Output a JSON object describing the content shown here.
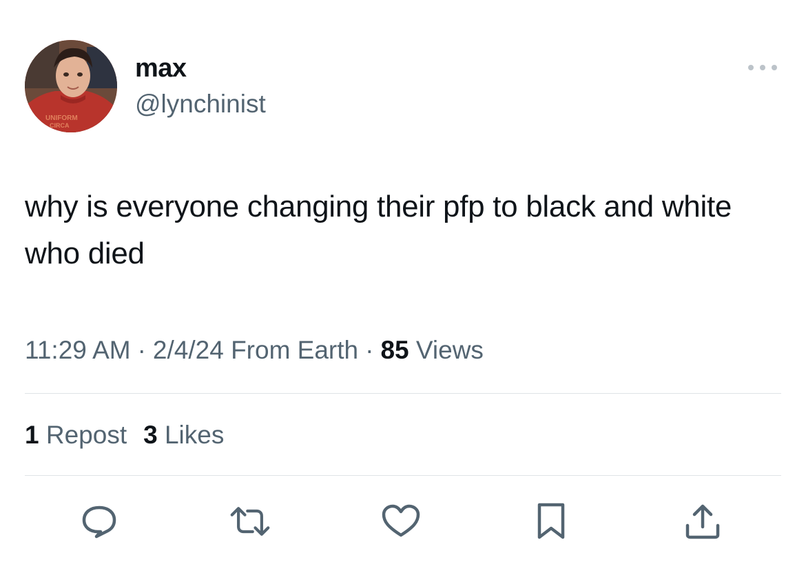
{
  "user": {
    "display_name": "max",
    "handle": "@lynchinist",
    "avatar_icon": "profile-photo"
  },
  "tweet": {
    "text": "why is everyone changing their pfp to black and white who died"
  },
  "meta": {
    "time": "11:29 AM",
    "separator": "·",
    "date": "2/4/24",
    "source": "From Earth",
    "views_count": "85",
    "views_label": "Views"
  },
  "stats": {
    "reposts_count": "1",
    "reposts_label": "Repost",
    "likes_count": "3",
    "likes_label": "Likes"
  },
  "actions": {
    "reply_icon": "reply-icon",
    "repost_icon": "repost-icon",
    "like_icon": "heart-icon",
    "bookmark_icon": "bookmark-icon",
    "share_icon": "share-icon"
  },
  "colors": {
    "text_primary": "#0f1419",
    "text_secondary": "#536471",
    "divider": "#dfe3e6"
  }
}
